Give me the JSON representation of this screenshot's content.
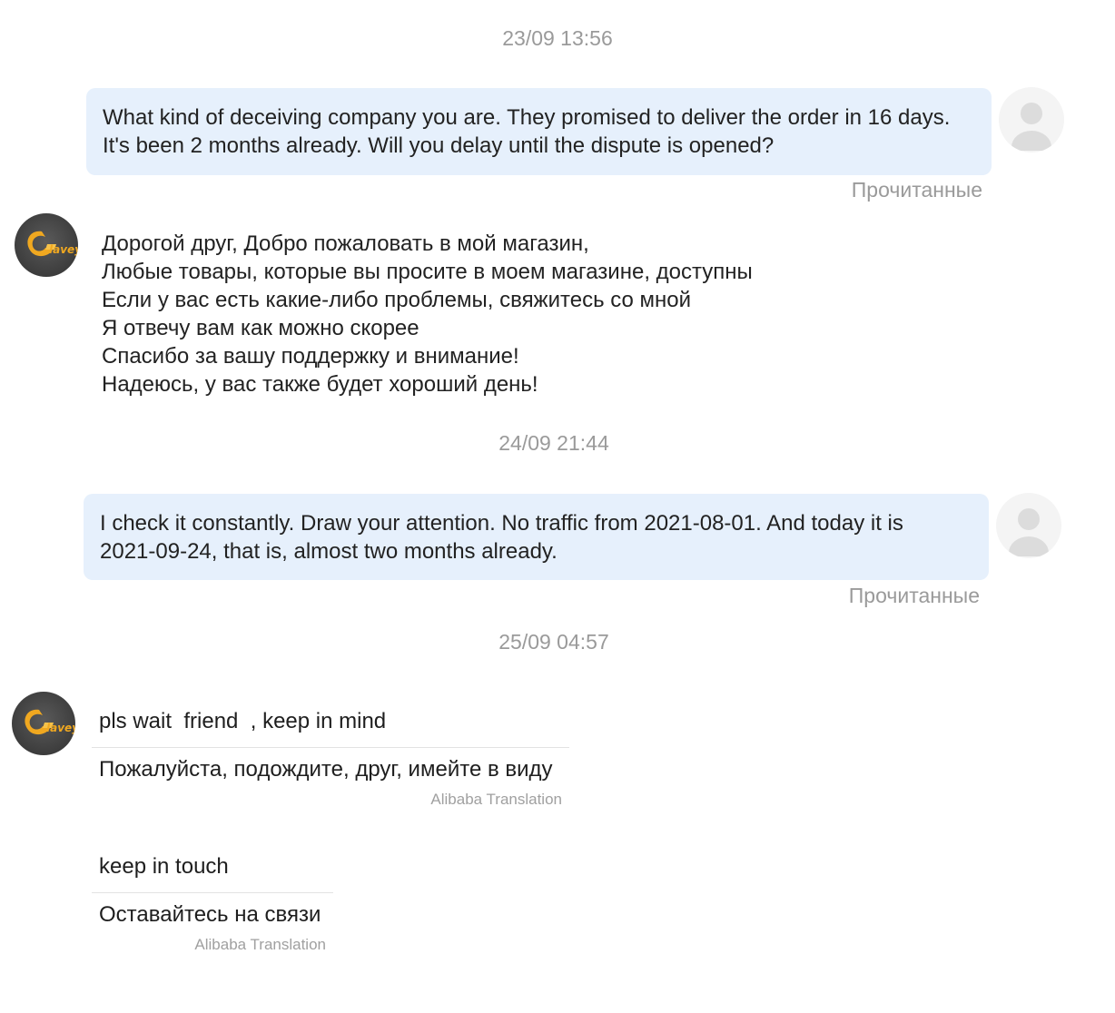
{
  "messages": {
    "ts1": "23/09 13:56",
    "m1": {
      "lines": [
        "What kind of deceiving company you are. They promised to deliver the order in 16 days.",
        "It's been 2 months already. Will you delay until the dispute is opened?"
      ],
      "status": "Прочитанные"
    },
    "m2": {
      "lines": [
        "Дорогой друг, Добро пожаловать в мой магазин,",
        "Любые товары, которые вы просите в моем магазине, доступны",
        "Если у вас есть какие-либо проблемы, свяжитесь со мной",
        "Я отвечу вам как можно скорее",
        "Спасибо за вашу поддержку и внимание!",
        "Надеюсь, у вас также будет хороший день!"
      ]
    },
    "ts2": "24/09 21:44",
    "m3": {
      "lines": [
        "I check it constantly. Draw your attention. No traffic from 2021-08-01. And today it is",
        "2021-09-24, that is, almost two months already."
      ],
      "status": "Прочитанные"
    },
    "ts3": "25/09 04:57",
    "m4": {
      "original": "pls wait  friend  , keep in mind",
      "translation": "Пожалуйста, подождите, друг, имейте в виду",
      "credit": "Alibaba Translation"
    },
    "m5": {
      "original": "keep in touch",
      "translation": "Оставайтесь на связи",
      "credit": "Alibaba Translation"
    }
  },
  "shop_avatar": {
    "logo_text": "lavey",
    "accent_color": "#f0a820"
  },
  "colors": {
    "outgoing_bubble": "#e6f0fc",
    "meta_text": "#9a9a9a"
  }
}
